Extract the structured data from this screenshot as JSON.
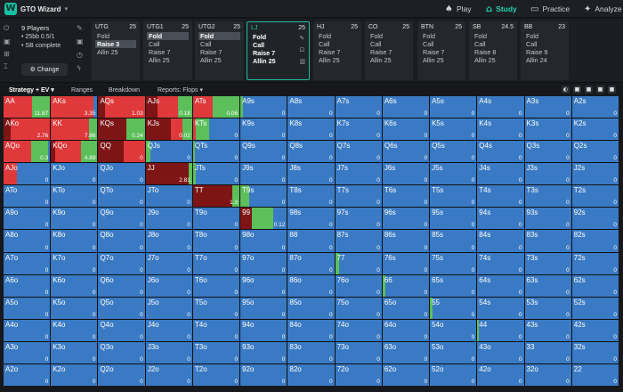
{
  "app": {
    "title": "GTO Wizard"
  },
  "nav": [
    {
      "label": "Play",
      "icon": "spade-icon",
      "active": false
    },
    {
      "label": "Study",
      "icon": "graduation-cap-icon",
      "active": true
    },
    {
      "label": "Practice",
      "icon": "gamepad-icon",
      "active": false
    },
    {
      "label": "Analyze",
      "icon": "analyze-icon",
      "active": false
    }
  ],
  "game": {
    "players": "9 Players",
    "stakes": "25bb 0.5/1",
    "status": "SB complete",
    "change_label": "Change"
  },
  "positions": [
    {
      "name": "UTG",
      "stack": "25",
      "actions": [
        "Fold",
        "Raise 3",
        "Allin 25"
      ],
      "selected": "Raise 3",
      "active": false
    },
    {
      "name": "UTG1",
      "stack": "25",
      "actions": [
        "Fold",
        "Call",
        "Raise 7",
        "Allin 25"
      ],
      "selected": "Fold",
      "active": false
    },
    {
      "name": "UTG2",
      "stack": "25",
      "actions": [
        "Fold",
        "Call",
        "Raise 7",
        "Allin 25"
      ],
      "selected": "Fold",
      "active": false
    },
    {
      "name": "LJ",
      "stack": "25",
      "actions": [
        "Fold",
        "Call",
        "Raise 7",
        "Allin 25"
      ],
      "selected": "",
      "active": true
    },
    {
      "name": "HJ",
      "stack": "25",
      "actions": [
        "Fold",
        "Call",
        "Raise 7",
        "Allin 25"
      ],
      "selected": "",
      "active": false
    },
    {
      "name": "CO",
      "stack": "25",
      "actions": [
        "Fold",
        "Call",
        "Raise 7",
        "Allin 25"
      ],
      "selected": "",
      "active": false
    },
    {
      "name": "BTN",
      "stack": "25",
      "actions": [
        "Fold",
        "Call",
        "Raise 7",
        "Allin 25"
      ],
      "selected": "",
      "active": false
    },
    {
      "name": "SB",
      "stack": "24.5",
      "actions": [
        "Fold",
        "Call",
        "Raise 8",
        "Allin 25"
      ],
      "selected": "",
      "active": false
    },
    {
      "name": "BB",
      "stack": "23",
      "actions": [
        "Fold",
        "Call",
        "Raise 9",
        "Allin 24"
      ],
      "selected": "",
      "active": false
    }
  ],
  "tabs": [
    {
      "label": "Strategy + EV ▾",
      "active": true
    },
    {
      "label": "Ranges",
      "active": false
    },
    {
      "label": "Breakdown",
      "active": false
    },
    {
      "label": "Reports: Flops ▾",
      "active": false
    }
  ],
  "colors": {
    "allin": "#7e1515",
    "raise": "#e0393b",
    "call": "#5cbf5a",
    "fold": "#3a7ac4",
    "accent": "#1fd1b0"
  },
  "hands": [
    [
      "AA",
      "AKs",
      "AQs",
      "AJs",
      "ATs",
      "A9s",
      "A8s",
      "A7s",
      "A6s",
      "A5s",
      "A4s",
      "A3s",
      "A2s"
    ],
    [
      "AKo",
      "KK",
      "KQs",
      "KJs",
      "KTs",
      "K9s",
      "K8s",
      "K7s",
      "K6s",
      "K5s",
      "K4s",
      "K3s",
      "K2s"
    ],
    [
      "AQo",
      "KQo",
      "QQ",
      "QJs",
      "QTs",
      "Q9s",
      "Q8s",
      "Q7s",
      "Q6s",
      "Q5s",
      "Q4s",
      "Q3s",
      "Q2s"
    ],
    [
      "AJo",
      "KJo",
      "QJo",
      "JJ",
      "JTs",
      "J9s",
      "J8s",
      "J7s",
      "J6s",
      "J5s",
      "J4s",
      "J3s",
      "J2s"
    ],
    [
      "ATo",
      "KTo",
      "QTo",
      "JTo",
      "TT",
      "T9s",
      "T8s",
      "T7s",
      "T6s",
      "T5s",
      "T4s",
      "T3s",
      "T2s"
    ],
    [
      "A9o",
      "K9o",
      "Q9o",
      "J9o",
      "T9o",
      "99",
      "98s",
      "97s",
      "96s",
      "95s",
      "94s",
      "93s",
      "92s"
    ],
    [
      "A8o",
      "K8o",
      "Q8o",
      "J8o",
      "T8o",
      "98o",
      "88",
      "87s",
      "86s",
      "85s",
      "84s",
      "83s",
      "82s"
    ],
    [
      "A7o",
      "K7o",
      "Q7o",
      "J7o",
      "T7o",
      "97o",
      "87o",
      "77",
      "76s",
      "75s",
      "74s",
      "73s",
      "72s"
    ],
    [
      "A6o",
      "K6o",
      "Q6o",
      "J6o",
      "T6o",
      "96o",
      "86o",
      "76o",
      "66",
      "65s",
      "64s",
      "63s",
      "62s"
    ],
    [
      "A5o",
      "K5o",
      "Q5o",
      "J5o",
      "T5o",
      "95o",
      "85o",
      "75o",
      "65o",
      "55",
      "54s",
      "53s",
      "52s"
    ],
    [
      "A4o",
      "K4o",
      "Q4o",
      "J4o",
      "T4o",
      "94o",
      "84o",
      "74o",
      "64o",
      "54o",
      "44",
      "43s",
      "42s"
    ],
    [
      "A3o",
      "K3o",
      "Q3o",
      "J3o",
      "T3o",
      "93o",
      "83o",
      "73o",
      "63o",
      "53o",
      "43o",
      "33",
      "32s"
    ],
    [
      "A2o",
      "K2o",
      "Q2o",
      "J2o",
      "T2o",
      "92o",
      "82o",
      "72o",
      "62o",
      "52o",
      "42o",
      "32o",
      "22"
    ]
  ],
  "ev": [
    [
      "11.87",
      "3.35",
      "1.03",
      "0.18",
      "0.06",
      "0",
      "0",
      "0",
      "0",
      "0",
      "0",
      "0",
      "0"
    ],
    [
      "2.76",
      "7.86",
      "0.24",
      "0.02",
      "0",
      "0",
      "0",
      "0",
      "0",
      "0",
      "0",
      "0",
      "0"
    ],
    [
      "0.3",
      "4.89",
      "0",
      "0",
      "0",
      "0",
      "0",
      "0",
      "0",
      "0",
      "0",
      "0",
      "0"
    ],
    [
      "0",
      "0",
      "0",
      "2.81",
      "0",
      "0",
      "0",
      "0",
      "0",
      "0",
      "0",
      "0",
      "0"
    ],
    [
      "0",
      "0",
      "0",
      "0",
      "1.3",
      "0",
      "0",
      "0",
      "0",
      "0",
      "0",
      "0",
      "0"
    ],
    [
      "0",
      "0",
      "0",
      "0",
      "0",
      "0.12",
      "0",
      "0",
      "0",
      "0",
      "0",
      "0",
      "0"
    ],
    [
      "0",
      "0",
      "0",
      "0",
      "0",
      "0",
      "0",
      "0",
      "0",
      "0",
      "0",
      "0",
      "0"
    ],
    [
      "0",
      "0",
      "0",
      "0",
      "0",
      "0",
      "0",
      "0",
      "0",
      "0",
      "0",
      "0",
      "0"
    ],
    [
      "0",
      "0",
      "0",
      "0",
      "0",
      "0",
      "0",
      "0",
      "0",
      "0",
      "0",
      "0",
      "0"
    ],
    [
      "0",
      "0",
      "0",
      "0",
      "0",
      "0",
      "0",
      "0",
      "0",
      "0",
      "0",
      "0",
      "0"
    ],
    [
      "0",
      "0",
      "0",
      "0",
      "0",
      "0",
      "0",
      "0",
      "0",
      "0",
      "0",
      "0",
      "0"
    ],
    [
      "0",
      "0",
      "0",
      "0",
      "0",
      "0",
      "0",
      "0",
      "0",
      "0",
      "0",
      "0",
      "0"
    ],
    [
      "0",
      "0",
      "0",
      "0",
      "0",
      "0",
      "0",
      "0",
      "0",
      "0",
      "0",
      "0",
      "0"
    ]
  ],
  "strategy": {
    "0,0": [
      0,
      0.62,
      0.38
    ],
    "0,1": [
      0,
      0.92,
      0
    ],
    "0,2": [
      0.15,
      0.85,
      0
    ],
    "0,3": [
      0.25,
      0.45,
      0.3
    ],
    "0,4": [
      0,
      0.42,
      0.58
    ],
    "0,5": [
      0,
      0,
      0.06
    ],
    "1,0": [
      0.15,
      0.85,
      0
    ],
    "1,1": [
      0,
      0.82,
      0.18
    ],
    "1,2": [
      0.6,
      0,
      0.4
    ],
    "1,3": [
      0.55,
      0.25,
      0.2
    ],
    "1,4": [
      0,
      0.05,
      0.3
    ],
    "2,0": [
      0,
      0.6,
      0.35
    ],
    "2,1": [
      0.1,
      0.55,
      0.35
    ],
    "2,2": [
      0.55,
      0.45,
      0
    ],
    "2,3": [
      0,
      0,
      0.1
    ],
    "2,4": [
      0,
      0,
      0.04
    ],
    "3,0": [
      0,
      0.28,
      0
    ],
    "3,3": [
      0.92,
      0,
      0.08
    ],
    "3,4": [
      0,
      0,
      0.06
    ],
    "4,4": [
      0.85,
      0,
      0.15
    ],
    "4,5": [
      0,
      0,
      0.18
    ],
    "5,5": [
      0.25,
      0,
      0.45
    ],
    "6,6": [
      0,
      0,
      0
    ],
    "7,7": [
      0,
      0,
      0.08
    ],
    "8,8": [
      0,
      0,
      0.07
    ],
    "9,9": [
      0,
      0,
      0.05
    ],
    "10,10": [
      0,
      0,
      0.04
    ]
  }
}
